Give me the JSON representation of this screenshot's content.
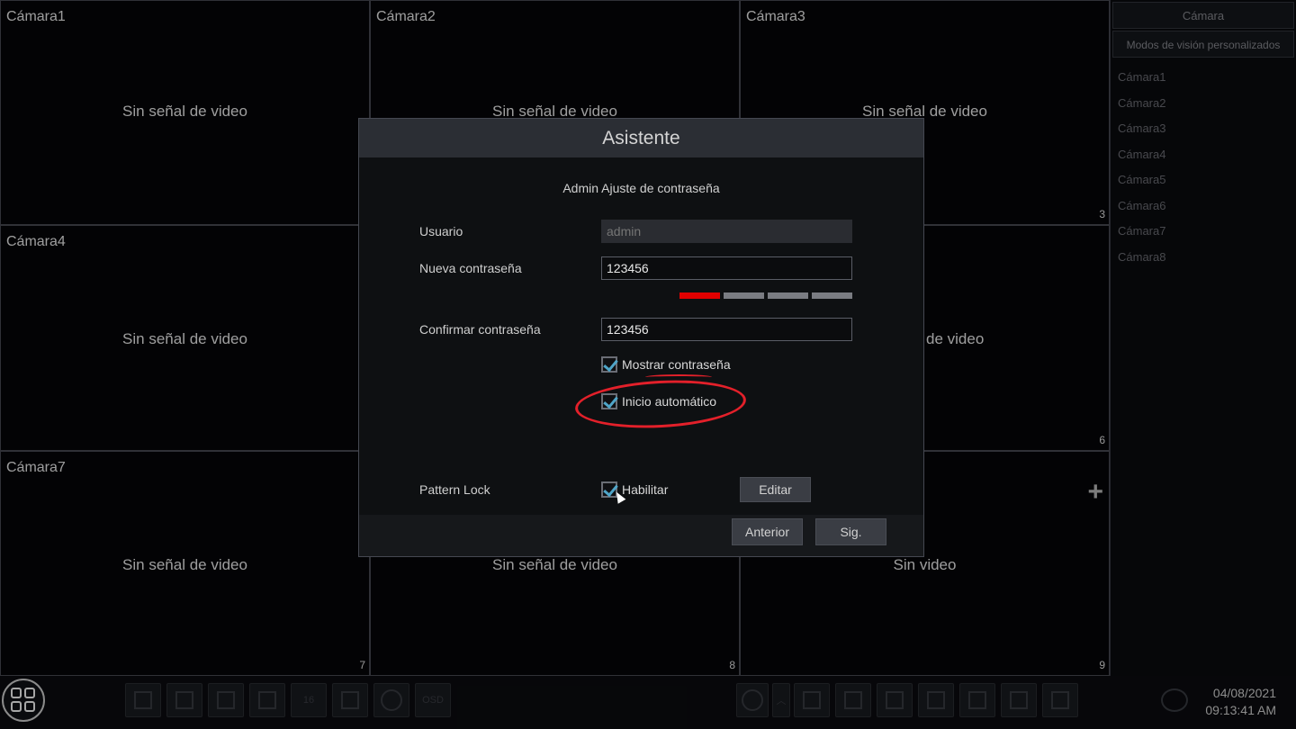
{
  "cameras": [
    {
      "name": "Cámara1",
      "status": "Sin señal de video",
      "num": ""
    },
    {
      "name": "Cámara2",
      "status": "Sin señal de video",
      "num": ""
    },
    {
      "name": "Cámara3",
      "status": "Sin señal de video",
      "num": "3"
    },
    {
      "name": "Cámara4",
      "status": "Sin señal de video",
      "num": ""
    },
    {
      "name": "",
      "status": "",
      "num": ""
    },
    {
      "name": "",
      "status": "de video",
      "num": "6"
    },
    {
      "name": "Cámara7",
      "status": "Sin señal de video",
      "num": "7"
    },
    {
      "name": "",
      "status": "Sin señal de video",
      "num": "8"
    },
    {
      "name": "",
      "status": "Sin video",
      "num": "9"
    }
  ],
  "side": {
    "tab_camera": "Cámara",
    "tab_custom": "Modos de visión personalizados",
    "items": [
      "Cámara1",
      "Cámara2",
      "Cámara3",
      "Cámara4",
      "Cámara5",
      "Cámara6",
      "Cámara7",
      "Cámara8"
    ]
  },
  "toolbar": {
    "osd_label": "OSD",
    "grid16_label": "16",
    "date": "04/08/2021",
    "time": "09:13:41 AM"
  },
  "dialog": {
    "title": "Asistente",
    "subtitle": "Admin Ajuste de contraseña",
    "user_label": "Usuario",
    "user_placeholder": "admin",
    "new_pw_label": "Nueva contraseña",
    "new_pw_value": "123456",
    "password_strength_level": 1,
    "password_strength_segments": 4,
    "confirm_label": "Confirmar contraseña",
    "confirm_value": "123456",
    "show_pw_label": "Mostrar contraseña",
    "show_pw_checked": true,
    "autostart_label": "Inicio automático",
    "autostart_checked": true,
    "pattern_label": "Pattern Lock",
    "enable_label": "Habilitar",
    "enable_checked": true,
    "edit_label": "Editar",
    "prev_label": "Anterior",
    "next_label": "Sig."
  },
  "colors": {
    "accent_check": "#4fa5c8",
    "strength_weak": "#e00000",
    "annotation": "#e3202a"
  }
}
